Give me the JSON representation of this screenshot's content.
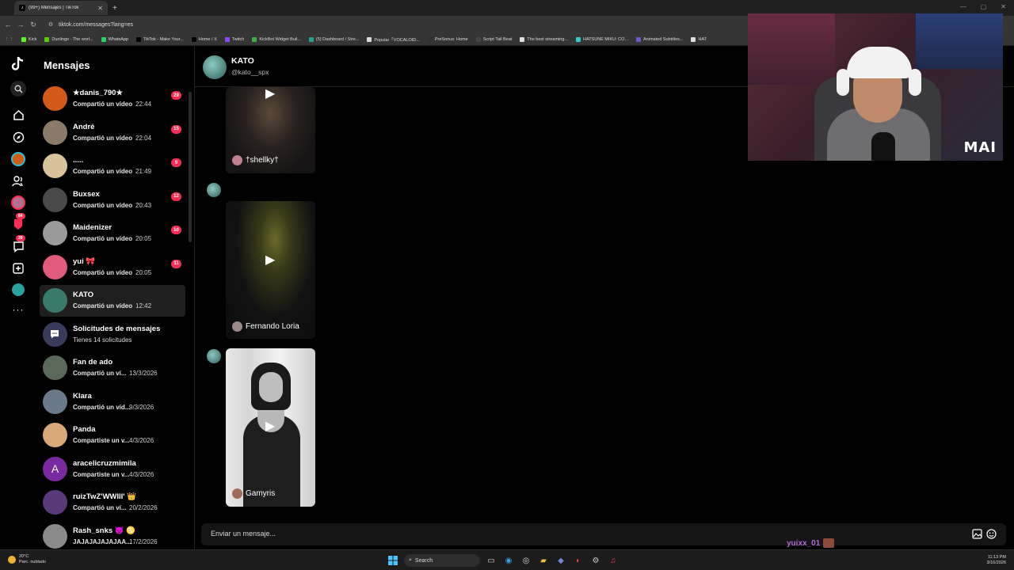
{
  "browser": {
    "tab_title": "(99+) Mensajes | TikTok",
    "url": "tiktok.com/messages?lang=es",
    "bookmarks": [
      "Kick",
      "Duolingo - The worl...",
      "WhatsApp",
      "TikTok - Make Your...",
      "Home / X",
      "Twitch",
      "KickBot Widget Buil...",
      "(5) Dashboard / Stre...",
      "Popular「VOCALOID...",
      "PreSonus: Home",
      "Script Tail Beat",
      "The best streaming...",
      "HATSUNE MIKU: CO...",
      "Animated Subtitles...",
      "HAT"
    ],
    "bookmark_colors": [
      "#53fc18",
      "#58cc02",
      "#25d366",
      "#000000",
      "#000000",
      "#9146ff",
      "#3cb043",
      "#2a9d8f",
      "#dddddd",
      "#333333",
      "#444444",
      "#dddddd",
      "#37c8c8",
      "#6a5acd",
      "#dddddd"
    ]
  },
  "rail": {
    "badges": {
      "activity": "84",
      "messages": "39"
    },
    "icons": [
      "tiktok-logo-icon",
      "search-icon",
      "home-icon",
      "explore-icon",
      "live-avatar-icon",
      "following-icon",
      "profile-avatar-icon",
      "activity-icon",
      "messages-icon",
      "upload-icon",
      "friends-avatar-icon",
      "more-icon"
    ]
  },
  "panel": {
    "title": "Mensajes",
    "conversations": [
      {
        "name": "★danis_790★",
        "msg": "Compartió un vídeo",
        "time": "22:44",
        "count": "29",
        "color": "#d45a1a"
      },
      {
        "name": "André",
        "msg": "Compartió un vídeo",
        "time": "22:04",
        "count": "15",
        "color": "#8a7a6a"
      },
      {
        "name": ".....",
        "msg": "Compartió un vídeo",
        "time": "21:49",
        "count": "9",
        "color": "#d9c39a"
      },
      {
        "name": "Buxsex",
        "msg": "Compartió un vídeo",
        "time": "20:43",
        "count": "12",
        "color": "#4a4a4a"
      },
      {
        "name": "Maidenizer",
        "msg": "Compartió un vídeo",
        "time": "20:05",
        "count": "10",
        "color": "#9a9a9a"
      },
      {
        "name": "yui 🎀",
        "msg": "Compartió un vídeo",
        "time": "20:05",
        "count": "11",
        "color": "#e05a7a"
      },
      {
        "name": "KATO",
        "msg": "Compartió un vídeo",
        "time": "12:42",
        "count": "",
        "color": "#3a7a6a",
        "active": true
      },
      {
        "name": "Solicitudes de mensajes",
        "msg": "Tienes 14 solicitudes",
        "time": "",
        "count": "",
        "color": "#3a3a5a"
      },
      {
        "name": "Fan de ado",
        "msg": "Compartió un ví...",
        "time": "13/3/2026",
        "count": "",
        "color": "#5a6a5a"
      },
      {
        "name": "Klara",
        "msg": "Compartió un víd...",
        "time": "9/3/2026",
        "count": "",
        "color": "#6a7a8a"
      },
      {
        "name": "Panda",
        "msg": "Compartiste un v...",
        "time": "4/3/2026",
        "count": "",
        "color": "#d8a878"
      },
      {
        "name": "aracelicruzmimila",
        "msg": "Compartiste un v...",
        "time": "4/3/2026",
        "count": "",
        "color": "#7a2aa0",
        "initial": "A"
      },
      {
        "name": "ruizTwZ'WWIII' 👑",
        "msg": "Compartió un ví...",
        "time": "20/2/2026",
        "count": "",
        "color": "#5a3a7a"
      },
      {
        "name": "Rash_snks 😈 ♋",
        "msg": "JAJAJAJAJAJAA...",
        "time": "17/2/2026",
        "count": "",
        "color": "#8a8a8a"
      }
    ]
  },
  "chat": {
    "name": "KATO",
    "handle": "@kato__spx",
    "videos": [
      {
        "author": "†shellky†",
        "author_color": "#c08090"
      },
      {
        "author": "Fernando Loria",
        "author_color": "#9a8a8a"
      },
      {
        "author": "Gamyris",
        "author_color": "#a06a5a"
      }
    ],
    "input_placeholder": "Enviar un mensaje..."
  },
  "overlay": {
    "username": "yuixx_01"
  },
  "webcam": {
    "logo": "MAI"
  },
  "taskbar": {
    "temperature": "20°C",
    "weather": "Parc. nublado",
    "search": "Search",
    "time": "11:13 PM",
    "date": "3/16/2026"
  }
}
